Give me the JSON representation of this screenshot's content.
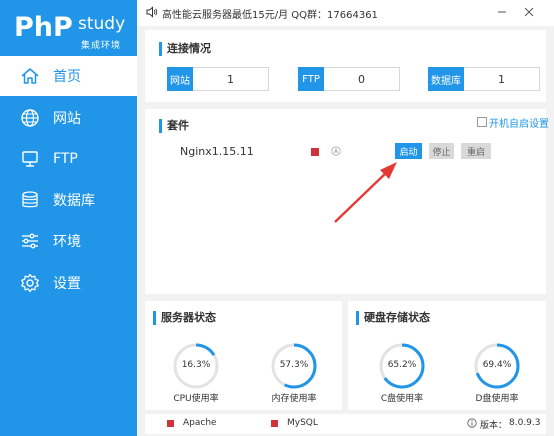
{
  "logo": {
    "brand": "PhP",
    "brand2": "study",
    "subtitle": "集成环境"
  },
  "nav": [
    {
      "label": "首页",
      "icon": "home-icon"
    },
    {
      "label": "网站",
      "icon": "globe-icon"
    },
    {
      "label": "FTP",
      "icon": "monitor-icon"
    },
    {
      "label": "数据库",
      "icon": "database-icon"
    },
    {
      "label": "环境",
      "icon": "sliders-icon"
    },
    {
      "label": "设置",
      "icon": "gear-icon"
    }
  ],
  "topbar": {
    "notice": "高性能云服务器最低15元/月  QQ群：17664361"
  },
  "connection": {
    "title": "连接情况",
    "website_label": "网站",
    "website_value": "1",
    "ftp_label": "FTP",
    "ftp_value": "0",
    "db_label": "数据库",
    "db_value": "1"
  },
  "suite": {
    "title": "套件",
    "autostart_label": "开机自启设置",
    "service_name": "Nginx1.15.11",
    "start_label": "启动",
    "stop_label": "停止",
    "restart_label": "重启"
  },
  "server_status": {
    "title": "服务器状态",
    "cpu_value": "16.3%",
    "cpu_label": "CPU使用率",
    "cpu_pct": 16.3,
    "mem_value": "57.3%",
    "mem_label": "内存使用率",
    "mem_pct": 57.3
  },
  "disk_status": {
    "title": "硬盘存储状态",
    "c_value": "65.2%",
    "c_label": "C盘使用率",
    "c_pct": 65.2,
    "d_value": "69.4%",
    "d_label": "D盘使用率",
    "d_pct": 69.4
  },
  "footer": {
    "apache_label": "Apache",
    "mysql_label": "MySQL",
    "version_label": "版本：",
    "version": "8.0.9.3"
  },
  "colors": {
    "accent": "#2196e8",
    "stopped": "#d0313a",
    "arrow": "#e53935"
  }
}
